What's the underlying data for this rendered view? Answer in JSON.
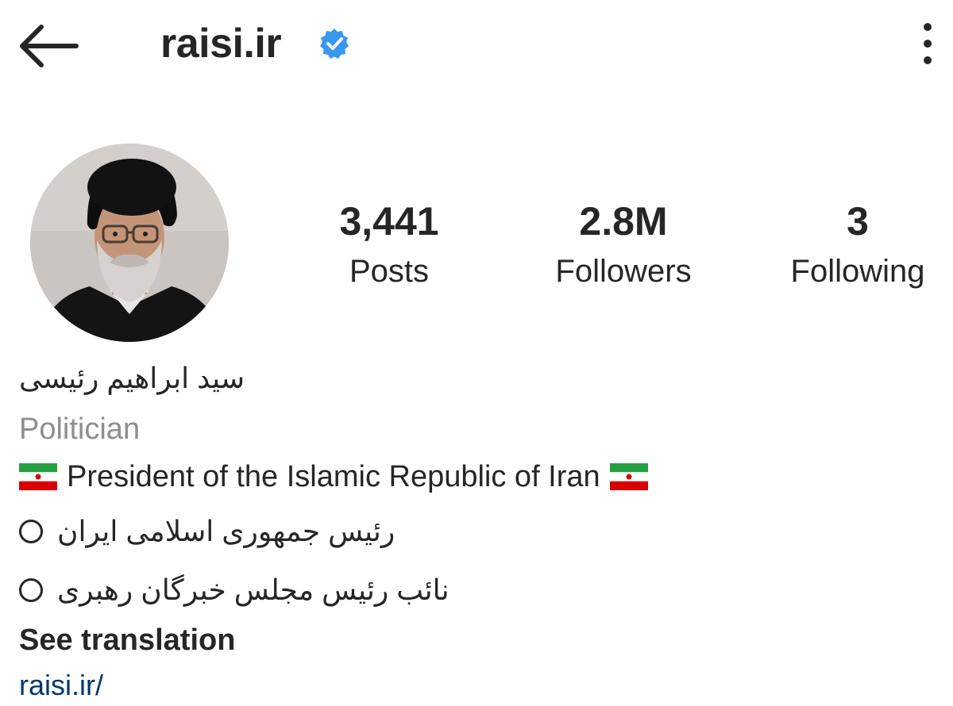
{
  "header": {
    "username": "raisi.ir",
    "back_icon": "arrow-left-icon",
    "verified_icon": "verified-badge-icon",
    "more_icon": "more-vertical-icon",
    "verified_color": "#3897f0"
  },
  "profile": {
    "avatar_alt": "profile-photo"
  },
  "stats": {
    "posts": {
      "value": "3,441",
      "label": "Posts"
    },
    "followers": {
      "value": "2.8M",
      "label": "Followers"
    },
    "following": {
      "value": "3",
      "label": "Following"
    }
  },
  "bio": {
    "full_name": "سید ابراهیم رئیسی",
    "category": "Politician",
    "title": "President of the Islamic Republic of Iran",
    "flag_icon": "iran-flag-icon",
    "lines_fa": [
      "رئیس جمهوری اسلامی ایران",
      "نائب رئیس مجلس خبرگان رهبری"
    ],
    "line_icon": "circle-outline-icon",
    "see_translation": "See translation",
    "website": "raisi.ir/"
  },
  "colors": {
    "text": "#262626",
    "secondary_text": "#8e8e8e",
    "link": "#00376b"
  }
}
